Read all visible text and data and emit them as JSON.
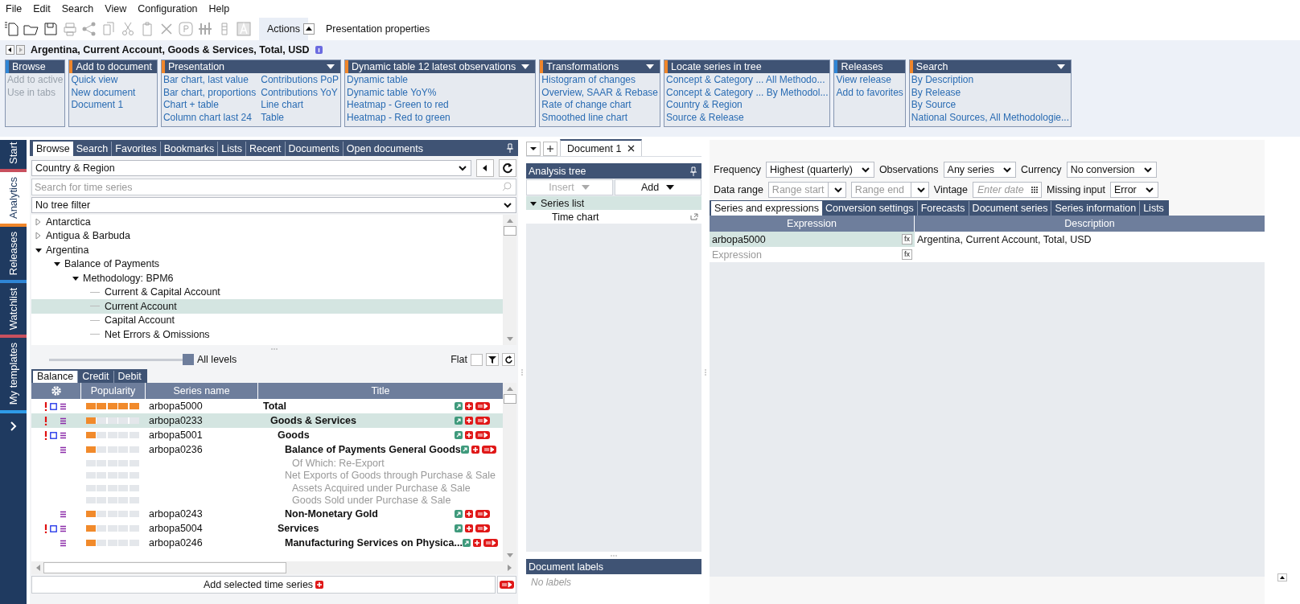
{
  "menu": [
    "File",
    "Edit",
    "Search",
    "View",
    "Configuration",
    "Help"
  ],
  "toolbar": [
    {
      "kind": "new",
      "disabled": false
    },
    {
      "kind": "open",
      "disabled": false
    },
    {
      "kind": "save",
      "disabled": false
    },
    {
      "kind": "print",
      "disabled": true
    },
    {
      "kind": "share",
      "disabled": true
    },
    {
      "kind": "copy",
      "disabled": true
    },
    {
      "kind": "cut",
      "disabled": true
    },
    {
      "kind": "paste",
      "disabled": true
    },
    {
      "kind": "delete",
      "disabled": true
    },
    {
      "kind": "p",
      "disabled": true
    },
    {
      "kind": "chart",
      "disabled": true
    },
    {
      "kind": "list",
      "disabled": true
    },
    {
      "kind": "a",
      "disabled": true
    }
  ],
  "ribbon_tabs": [
    {
      "label": "Actions",
      "selected": true
    },
    {
      "label": "Presentation properties",
      "selected": false
    }
  ],
  "series_title": "Argentina, Current Account, Goods & Services, Total, USD",
  "ribbon_groups": [
    {
      "title": "Browse",
      "color": "#2f86d6",
      "dropdown": false,
      "columns": [
        [
          {
            "label": "Add to active",
            "disabled": true
          },
          {
            "label": "Use in tabs",
            "disabled": true
          }
        ]
      ]
    },
    {
      "title": "Add to document",
      "color": "#f0862a",
      "dropdown": false,
      "columns": [
        [
          {
            "label": "Quick view",
            "disabled": false
          },
          {
            "label": "New document",
            "disabled": false
          },
          {
            "label": "Document 1",
            "disabled": false
          }
        ]
      ]
    },
    {
      "title": "Presentation",
      "color": "#f0862a",
      "dropdown": true,
      "columns": [
        [
          {
            "label": "Bar chart, last value",
            "disabled": false
          },
          {
            "label": "Bar chart, proportions",
            "disabled": false
          },
          {
            "label": "Chart + table",
            "disabled": false
          },
          {
            "label": "Column chart last 24",
            "disabled": false
          }
        ],
        [
          {
            "label": "Contributions PoP",
            "disabled": false
          },
          {
            "label": "Contributions YoY",
            "disabled": false
          },
          {
            "label": "Line chart",
            "disabled": false
          },
          {
            "label": "Table",
            "disabled": false
          }
        ]
      ]
    },
    {
      "title": "Dynamic table 12 latest observations",
      "color": "#f0862a",
      "dropdown": true,
      "columns": [
        [
          {
            "label": "Dynamic table",
            "disabled": false
          },
          {
            "label": "Dynamic table YoY%",
            "disabled": false
          },
          {
            "label": "Heatmap - Green to red",
            "disabled": false
          },
          {
            "label": "Heatmap - Red to green",
            "disabled": false
          }
        ]
      ]
    },
    {
      "title": "Transformations",
      "color": "#f0862a",
      "dropdown": true,
      "columns": [
        [
          {
            "label": "Histogram of changes",
            "disabled": false
          },
          {
            "label": "Overview, SAAR & Rebase",
            "disabled": false
          },
          {
            "label": "Rate of change chart",
            "disabled": false
          },
          {
            "label": "Smoothed line chart",
            "disabled": false
          }
        ]
      ]
    },
    {
      "title": "Locate series in tree",
      "color": "#f0862a",
      "dropdown": false,
      "columns": [
        [
          {
            "label": "Concept & Category ... All Methodo...",
            "disabled": false
          },
          {
            "label": "Concept & Category ... By Methodol...",
            "disabled": false
          },
          {
            "label": "Country & Region",
            "disabled": false
          },
          {
            "label": "Source & Release",
            "disabled": false
          }
        ]
      ]
    },
    {
      "title": "Releases",
      "color": "#2f86d6",
      "dropdown": false,
      "columns": [
        [
          {
            "label": "View release",
            "disabled": false
          },
          {
            "label": "Add to favorites",
            "disabled": false
          }
        ]
      ]
    },
    {
      "title": "Search",
      "color": "#f0862a",
      "dropdown": true,
      "columns": [
        [
          {
            "label": "By Description",
            "disabled": false
          },
          {
            "label": "By Release",
            "disabled": false
          },
          {
            "label": "By Source",
            "disabled": false
          },
          {
            "label": "National Sources, All Methodologie...",
            "disabled": false
          }
        ]
      ]
    }
  ],
  "sidebar": [
    {
      "label": "Start",
      "color": "#c8505e",
      "selected": false
    },
    {
      "label": "Analytics",
      "color": "#f0862a",
      "selected": true
    },
    {
      "label": "Releases",
      "color": "#2f86d6",
      "selected": false
    },
    {
      "label": "Watchlist",
      "color": "#c8505e",
      "selected": false
    },
    {
      "label": "My templates",
      "color": "#2f9be8",
      "selected": false
    }
  ],
  "browser": {
    "tabs": [
      {
        "label": "Browse",
        "selected": true
      },
      {
        "label": "Search",
        "selected": false
      },
      {
        "label": "Favorites",
        "selected": false
      },
      {
        "label": "Bookmarks",
        "selected": false
      },
      {
        "label": "Lists",
        "selected": false
      },
      {
        "label": "Recent",
        "selected": false
      },
      {
        "label": "Documents",
        "selected": false
      },
      {
        "label": "Open documents",
        "selected": false
      }
    ],
    "category": "Country & Region",
    "search_placeholder": "Search for time series",
    "filter": "No tree filter",
    "tree": [
      {
        "label": "Antarctica",
        "expanded": false,
        "selected": false
      },
      {
        "label": "Antigua & Barbuda",
        "expanded": false,
        "selected": false
      },
      {
        "label": "Argentina",
        "expanded": true,
        "selected": false,
        "children": [
          {
            "label": "Balance of Payments",
            "expanded": true,
            "selected": false,
            "children": [
              {
                "label": "Methodology: BPM6",
                "expanded": true,
                "selected": false,
                "children": [
                  {
                    "label": "Current & Capital Account",
                    "selected": false
                  },
                  {
                    "label": "Current Account",
                    "selected": true
                  },
                  {
                    "label": "Capital Account",
                    "selected": false
                  },
                  {
                    "label": "Net Errors & Omissions",
                    "selected": false
                  }
                ]
              }
            ]
          }
        ]
      }
    ],
    "level_label": "All levels",
    "level": 1,
    "flat_label": "Flat",
    "flat_checked": false,
    "sub_tabs": [
      {
        "label": "Balance",
        "selected": true
      },
      {
        "label": "Credit",
        "selected": false
      },
      {
        "label": "Debit",
        "selected": false
      }
    ],
    "columns": [
      "Popularity",
      "Series name",
      "Title"
    ],
    "rows": [
      {
        "name": "arbopa5000",
        "title": "Total",
        "alert": true,
        "square": true,
        "menu": true,
        "level": 1,
        "available": true,
        "selected": false,
        "children": [
          {
            "name": "arbopa0233",
            "title": "Goods & Services",
            "alert": true,
            "square": false,
            "menu": true,
            "level": 0.2,
            "available": true,
            "selected": true,
            "children": [
              {
                "name": "arbopa5001",
                "title": "Goods",
                "alert": true,
                "square": true,
                "menu": true,
                "level": 0.2,
                "available": true,
                "selected": false,
                "children": [
                  {
                    "name": "arbopa0236",
                    "title": "Balance of Payments General Goods",
                    "alert": false,
                    "square": false,
                    "menu": true,
                    "level": 0.2,
                    "available": true,
                    "selected": false,
                    "children": [
                      {
                        "title": "Of Which: Re-Export",
                        "alert": false,
                        "square": false,
                        "menu": false,
                        "level": 0,
                        "available": false,
                        "selected": false
                      }
                    ]
                  },
                  {
                    "title": "Net Exports of Goods through Purchase & Sale",
                    "alert": false,
                    "square": false,
                    "menu": false,
                    "level": 0,
                    "available": false,
                    "selected": false,
                    "children": [
                      {
                        "title": "Assets Acquired under Purchase & Sale",
                        "alert": false,
                        "square": false,
                        "menu": false,
                        "level": 0,
                        "available": false,
                        "selected": false
                      },
                      {
                        "title": "Goods Sold under Purchase & Sale",
                        "alert": false,
                        "square": false,
                        "menu": false,
                        "level": 0,
                        "available": false,
                        "selected": false
                      }
                    ]
                  },
                  {
                    "name": "arbopa0243",
                    "title": "Non-Monetary Gold",
                    "alert": false,
                    "square": false,
                    "menu": true,
                    "level": 0.2,
                    "available": true,
                    "selected": false
                  }
                ]
              },
              {
                "name": "arbopa5004",
                "title": "Services",
                "alert": true,
                "square": true,
                "menu": true,
                "level": 0.2,
                "available": true,
                "selected": false,
                "children": [
                  {
                    "name": "arbopa0246",
                    "title": "Manufacturing Services on Physica...",
                    "alert": false,
                    "square": false,
                    "menu": true,
                    "level": 0.2,
                    "available": true,
                    "selected": false
                  }
                ]
              }
            ]
          }
        ]
      }
    ],
    "add_label": "Add selected time series"
  },
  "document_tabs": [
    {
      "label": "Document 1",
      "selected": true
    }
  ],
  "analysis_tree": {
    "title": "Analysis tree",
    "insert": {
      "label": "Insert",
      "disabled": true
    },
    "add": {
      "label": "Add",
      "disabled": false
    },
    "nodes": [
      {
        "label": "Series list",
        "expanded": true,
        "selected": true,
        "children": [
          {
            "label": "Time chart",
            "selected": false
          }
        ]
      }
    ]
  },
  "labels_panel": {
    "title": "Document labels",
    "empty_text": "No labels"
  },
  "settings": [
    [
      {
        "label": "Frequency",
        "controls": [
          {
            "kind": "select",
            "value": "Highest (quarterly)"
          }
        ]
      },
      {
        "label": "Observations",
        "controls": [
          {
            "kind": "select",
            "value": "Any series"
          }
        ]
      },
      {
        "label": "Currency",
        "controls": [
          {
            "kind": "select",
            "value": "No conversion"
          }
        ]
      }
    ],
    [
      {
        "label": "Data range",
        "controls": [
          {
            "kind": "combo",
            "placeholder": "Range start"
          },
          {
            "kind": "combo",
            "placeholder": "Range end"
          }
        ]
      },
      {
        "label": "Vintage",
        "controls": [
          {
            "kind": "date",
            "placeholder": "Enter date"
          }
        ]
      },
      {
        "label": "Missing input",
        "controls": [
          {
            "kind": "select",
            "value": "Error"
          }
        ]
      }
    ]
  ],
  "doc_tabs": [
    {
      "label": "Series and expressions",
      "selected": true
    },
    {
      "label": "Conversion settings",
      "selected": false
    },
    {
      "label": "Forecasts",
      "selected": false
    },
    {
      "label": "Document series",
      "selected": false
    },
    {
      "label": "Series information",
      "selected": false
    },
    {
      "label": "Lists",
      "selected": false
    }
  ],
  "expr_table": {
    "columns": [
      "Expression",
      "Description"
    ],
    "rows": [
      {
        "expression": "arbopa5000",
        "description": "Argentina, Current Account, Total, USD",
        "selected": true,
        "function": "fx"
      }
    ],
    "new_row_placeholder": "Expression",
    "new_row_function": "fx"
  }
}
